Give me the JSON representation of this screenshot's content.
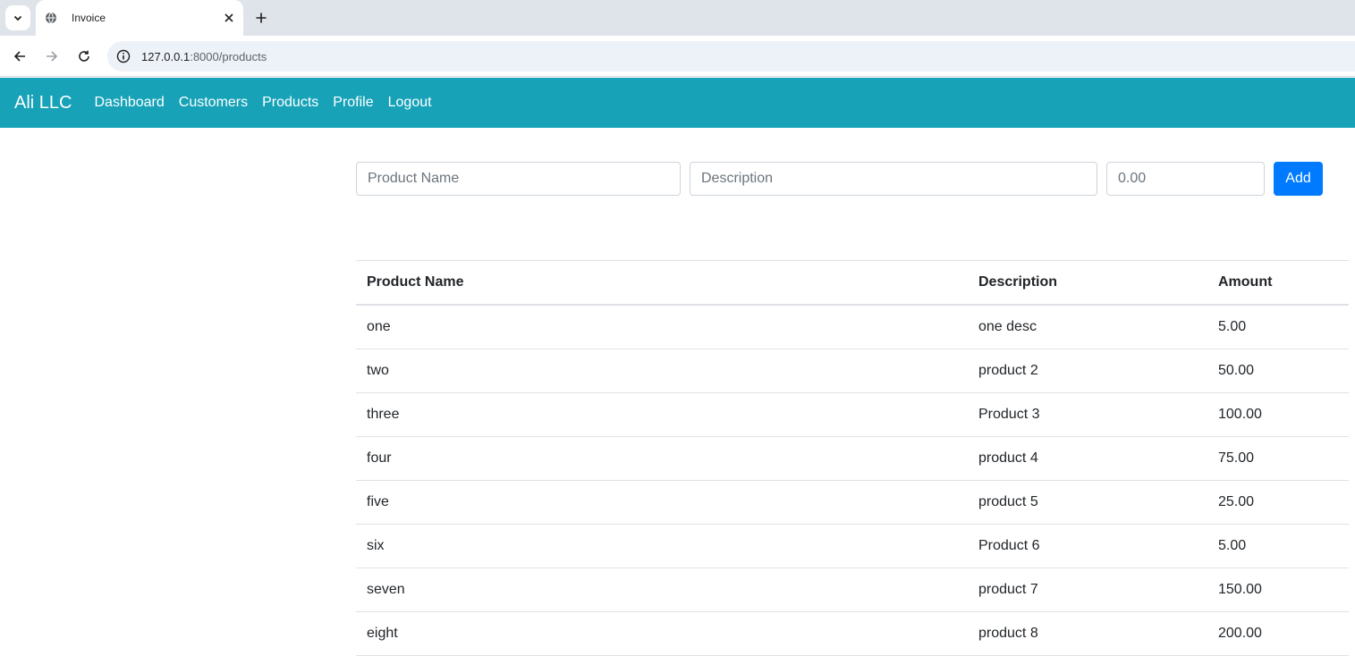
{
  "browser": {
    "tab_title": "Invoice",
    "url_host": "127.0.0.1",
    "url_path": ":8000/products"
  },
  "navbar": {
    "brand": "Ali LLC",
    "links": [
      "Dashboard",
      "Customers",
      "Products",
      "Profile",
      "Logout"
    ],
    "color": "#17a2b8"
  },
  "form": {
    "name_placeholder": "Product Name",
    "description_placeholder": "Description",
    "amount_placeholder": "0.00",
    "add_label": "Add",
    "add_color": "#007bff"
  },
  "table": {
    "headers": [
      "Product Name",
      "Description",
      "Amount"
    ],
    "rows": [
      [
        "one",
        "one desc",
        "5.00"
      ],
      [
        "two",
        "product 2",
        "50.00"
      ],
      [
        "three",
        "Product 3",
        "100.00"
      ],
      [
        "four",
        "product 4",
        "75.00"
      ],
      [
        "five",
        "product 5",
        "25.00"
      ],
      [
        "six",
        "Product 6",
        "5.00"
      ],
      [
        "seven",
        "product 7",
        "150.00"
      ],
      [
        "eight",
        "product 8",
        "200.00"
      ]
    ]
  }
}
